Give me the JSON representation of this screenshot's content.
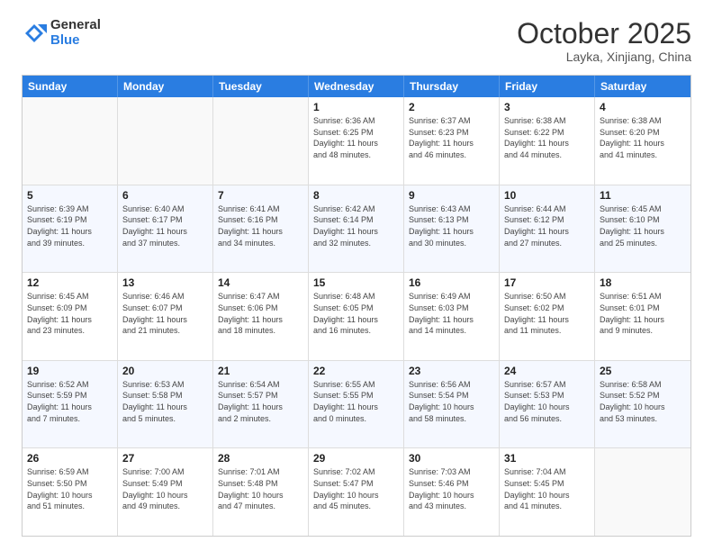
{
  "header": {
    "logo_line1": "General",
    "logo_line2": "Blue",
    "month": "October 2025",
    "location": "Layka, Xinjiang, China"
  },
  "weekdays": [
    "Sunday",
    "Monday",
    "Tuesday",
    "Wednesday",
    "Thursday",
    "Friday",
    "Saturday"
  ],
  "weeks": [
    [
      {
        "day": "",
        "info": ""
      },
      {
        "day": "",
        "info": ""
      },
      {
        "day": "",
        "info": ""
      },
      {
        "day": "1",
        "info": "Sunrise: 6:36 AM\nSunset: 6:25 PM\nDaylight: 11 hours\nand 48 minutes."
      },
      {
        "day": "2",
        "info": "Sunrise: 6:37 AM\nSunset: 6:23 PM\nDaylight: 11 hours\nand 46 minutes."
      },
      {
        "day": "3",
        "info": "Sunrise: 6:38 AM\nSunset: 6:22 PM\nDaylight: 11 hours\nand 44 minutes."
      },
      {
        "day": "4",
        "info": "Sunrise: 6:38 AM\nSunset: 6:20 PM\nDaylight: 11 hours\nand 41 minutes."
      }
    ],
    [
      {
        "day": "5",
        "info": "Sunrise: 6:39 AM\nSunset: 6:19 PM\nDaylight: 11 hours\nand 39 minutes."
      },
      {
        "day": "6",
        "info": "Sunrise: 6:40 AM\nSunset: 6:17 PM\nDaylight: 11 hours\nand 37 minutes."
      },
      {
        "day": "7",
        "info": "Sunrise: 6:41 AM\nSunset: 6:16 PM\nDaylight: 11 hours\nand 34 minutes."
      },
      {
        "day": "8",
        "info": "Sunrise: 6:42 AM\nSunset: 6:14 PM\nDaylight: 11 hours\nand 32 minutes."
      },
      {
        "day": "9",
        "info": "Sunrise: 6:43 AM\nSunset: 6:13 PM\nDaylight: 11 hours\nand 30 minutes."
      },
      {
        "day": "10",
        "info": "Sunrise: 6:44 AM\nSunset: 6:12 PM\nDaylight: 11 hours\nand 27 minutes."
      },
      {
        "day": "11",
        "info": "Sunrise: 6:45 AM\nSunset: 6:10 PM\nDaylight: 11 hours\nand 25 minutes."
      }
    ],
    [
      {
        "day": "12",
        "info": "Sunrise: 6:45 AM\nSunset: 6:09 PM\nDaylight: 11 hours\nand 23 minutes."
      },
      {
        "day": "13",
        "info": "Sunrise: 6:46 AM\nSunset: 6:07 PM\nDaylight: 11 hours\nand 21 minutes."
      },
      {
        "day": "14",
        "info": "Sunrise: 6:47 AM\nSunset: 6:06 PM\nDaylight: 11 hours\nand 18 minutes."
      },
      {
        "day": "15",
        "info": "Sunrise: 6:48 AM\nSunset: 6:05 PM\nDaylight: 11 hours\nand 16 minutes."
      },
      {
        "day": "16",
        "info": "Sunrise: 6:49 AM\nSunset: 6:03 PM\nDaylight: 11 hours\nand 14 minutes."
      },
      {
        "day": "17",
        "info": "Sunrise: 6:50 AM\nSunset: 6:02 PM\nDaylight: 11 hours\nand 11 minutes."
      },
      {
        "day": "18",
        "info": "Sunrise: 6:51 AM\nSunset: 6:01 PM\nDaylight: 11 hours\nand 9 minutes."
      }
    ],
    [
      {
        "day": "19",
        "info": "Sunrise: 6:52 AM\nSunset: 5:59 PM\nDaylight: 11 hours\nand 7 minutes."
      },
      {
        "day": "20",
        "info": "Sunrise: 6:53 AM\nSunset: 5:58 PM\nDaylight: 11 hours\nand 5 minutes."
      },
      {
        "day": "21",
        "info": "Sunrise: 6:54 AM\nSunset: 5:57 PM\nDaylight: 11 hours\nand 2 minutes."
      },
      {
        "day": "22",
        "info": "Sunrise: 6:55 AM\nSunset: 5:55 PM\nDaylight: 11 hours\nand 0 minutes."
      },
      {
        "day": "23",
        "info": "Sunrise: 6:56 AM\nSunset: 5:54 PM\nDaylight: 10 hours\nand 58 minutes."
      },
      {
        "day": "24",
        "info": "Sunrise: 6:57 AM\nSunset: 5:53 PM\nDaylight: 10 hours\nand 56 minutes."
      },
      {
        "day": "25",
        "info": "Sunrise: 6:58 AM\nSunset: 5:52 PM\nDaylight: 10 hours\nand 53 minutes."
      }
    ],
    [
      {
        "day": "26",
        "info": "Sunrise: 6:59 AM\nSunset: 5:50 PM\nDaylight: 10 hours\nand 51 minutes."
      },
      {
        "day": "27",
        "info": "Sunrise: 7:00 AM\nSunset: 5:49 PM\nDaylight: 10 hours\nand 49 minutes."
      },
      {
        "day": "28",
        "info": "Sunrise: 7:01 AM\nSunset: 5:48 PM\nDaylight: 10 hours\nand 47 minutes."
      },
      {
        "day": "29",
        "info": "Sunrise: 7:02 AM\nSunset: 5:47 PM\nDaylight: 10 hours\nand 45 minutes."
      },
      {
        "day": "30",
        "info": "Sunrise: 7:03 AM\nSunset: 5:46 PM\nDaylight: 10 hours\nand 43 minutes."
      },
      {
        "day": "31",
        "info": "Sunrise: 7:04 AM\nSunset: 5:45 PM\nDaylight: 10 hours\nand 41 minutes."
      },
      {
        "day": "",
        "info": ""
      }
    ]
  ]
}
